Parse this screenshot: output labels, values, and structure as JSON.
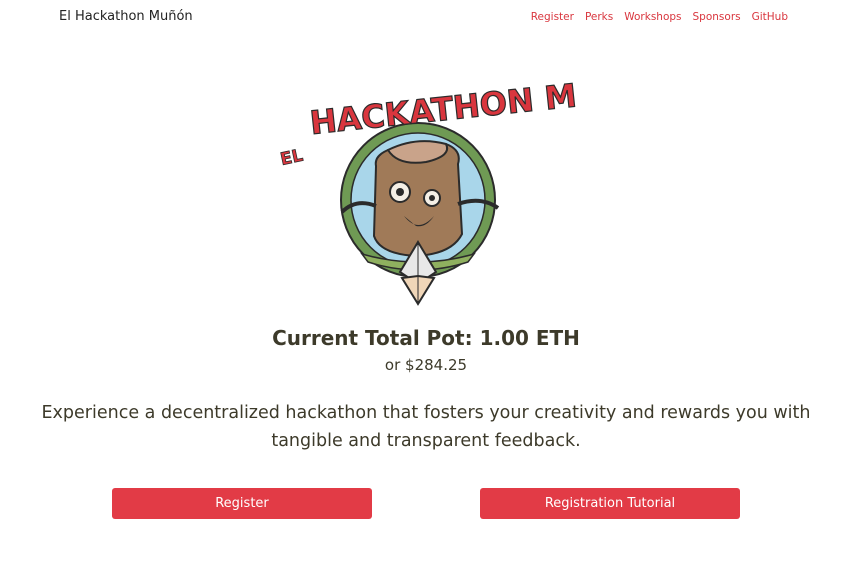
{
  "navbar": {
    "brand": "El Hackathon Muñón",
    "links": [
      "Register",
      "Perks",
      "Workshops",
      "Sponsors",
      "GitHub"
    ]
  },
  "logo": {
    "text": "El Hackathon Muñón",
    "colors": {
      "red": "#d9363e",
      "green": "#6f9a54",
      "sky": "#a9d6ea",
      "wood": "#a07a58"
    }
  },
  "pot": {
    "title": "Current Total Pot: 1.00 ETH",
    "subtitle": "or $284.25"
  },
  "tagline": "Experience a decentralized hackathon that fosters your creativity and rewards you with tangible and transparent feedback.",
  "buttons": {
    "register": "Register",
    "tutorial": "Registration Tutorial"
  },
  "colors": {
    "accent": "#e23b46",
    "text": "#3d3a2a"
  }
}
